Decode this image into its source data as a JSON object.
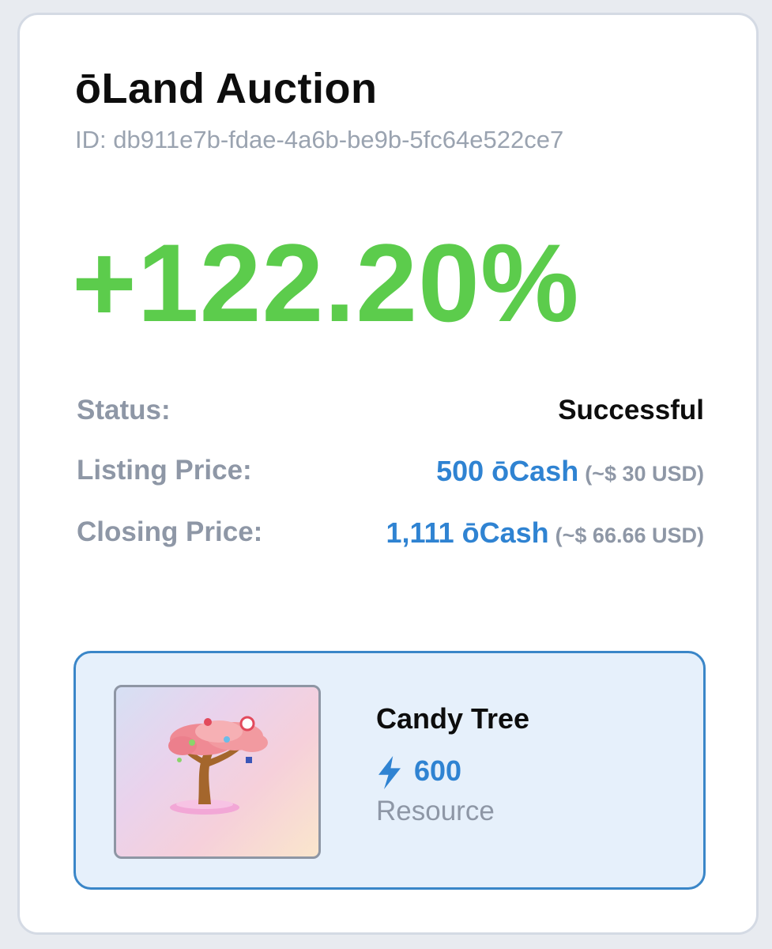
{
  "auction": {
    "title": "ōLand Auction",
    "id_text": "ID: db911e7b-fdae-4a6b-be9b-5fc64e522ce7",
    "change": "+122.20%"
  },
  "details": {
    "status_label": "Status:",
    "status_value": "Successful",
    "listing_label": "Listing Price:",
    "listing_amount": "500 ōCash",
    "listing_usd": "(~$ 30 USD)",
    "closing_label": "Closing Price:",
    "closing_amount": "1,111 ōCash",
    "closing_usd": "(~$ 66.66 USD)"
  },
  "item": {
    "name": "Candy Tree",
    "power_icon": "lightning-bolt-icon",
    "power": "600",
    "type": "Resource"
  },
  "colors": {
    "positive": "#5ccc4c",
    "accent": "#2f83d2",
    "muted": "#8e97a6"
  }
}
